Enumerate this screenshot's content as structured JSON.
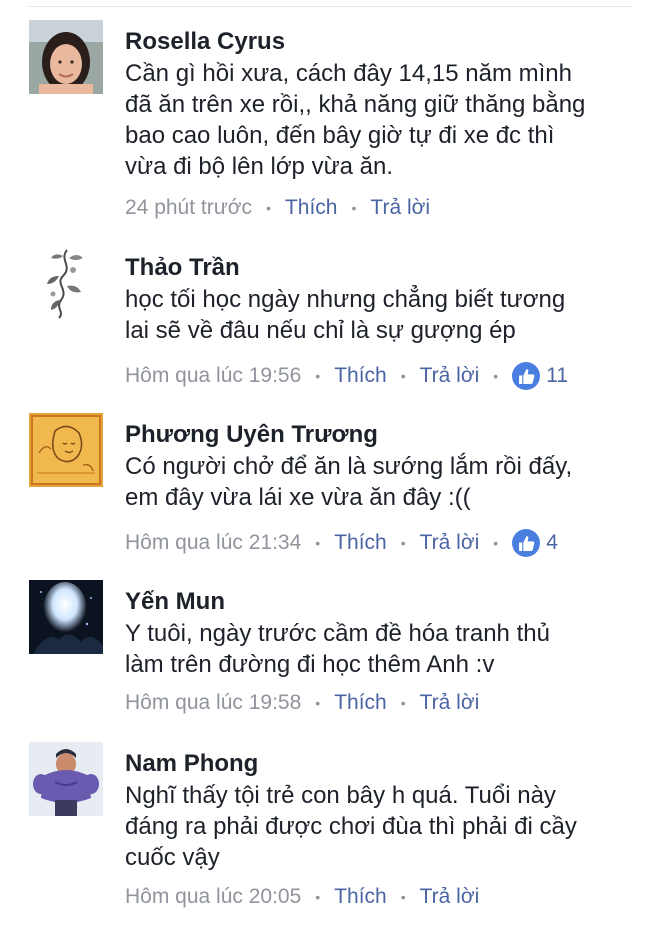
{
  "comments": [
    {
      "author": "Rosella Cyrus",
      "lines": [
        "Cần gì hồi xưa, cách đây 14,15 năm mình",
        "đã ăn trên xe rồi,, khả năng giữ thăng bằng",
        "bao cao luôn, đến bây giờ tự đi xe đc thì",
        "vừa đi bộ lên lớp vừa ăn."
      ],
      "time": "24 phút trước",
      "like_label": "Thích",
      "reply_label": "Trả lời"
    },
    {
      "author": "Thảo Trần",
      "lines": [
        "học tối học ngày nhưng chẳng biết tương",
        "lai sẽ về đâu nếu chỉ là sự gượng ép"
      ],
      "time": "Hôm qua lúc 19:56",
      "like_label": "Thích",
      "reply_label": "Trả lời",
      "reaction_count": "11"
    },
    {
      "author": "Phương Uyên Trương",
      "lines": [
        "Có người chở để ăn là sướng lắm rồi đấy,",
        "em đây vừa lái xe vừa ăn đây :(("
      ],
      "time": "Hôm qua lúc 21:34",
      "like_label": "Thích",
      "reply_label": "Trả lời",
      "reaction_count": "4"
    },
    {
      "author": "Yến Mun",
      "lines": [
        "Y tuôi, ngày trước cầm đề hóa tranh thủ",
        "làm trên đường đi học thêm Anh :v"
      ],
      "time": "Hôm qua lúc 19:58",
      "like_label": "Thích",
      "reply_label": "Trả lời"
    },
    {
      "author": "Nam Phong",
      "lines": [
        "Nghĩ thấy tội trẻ con bây h quá. Tuổi này",
        "đáng ra phải được chơi đùa thì phải đi cầy",
        "cuốc vậy"
      ],
      "time": "Hôm qua lúc 20:05",
      "like_label": "Thích",
      "reply_label": "Trả lời"
    }
  ],
  "icons": {
    "dot": "•",
    "reaction_icon": "like-thumb-icon"
  },
  "colors": {
    "author_text": "#1d2129",
    "meta_text": "#90949c",
    "link": "#4b64a4",
    "like_badge": "#4a7fe0"
  }
}
